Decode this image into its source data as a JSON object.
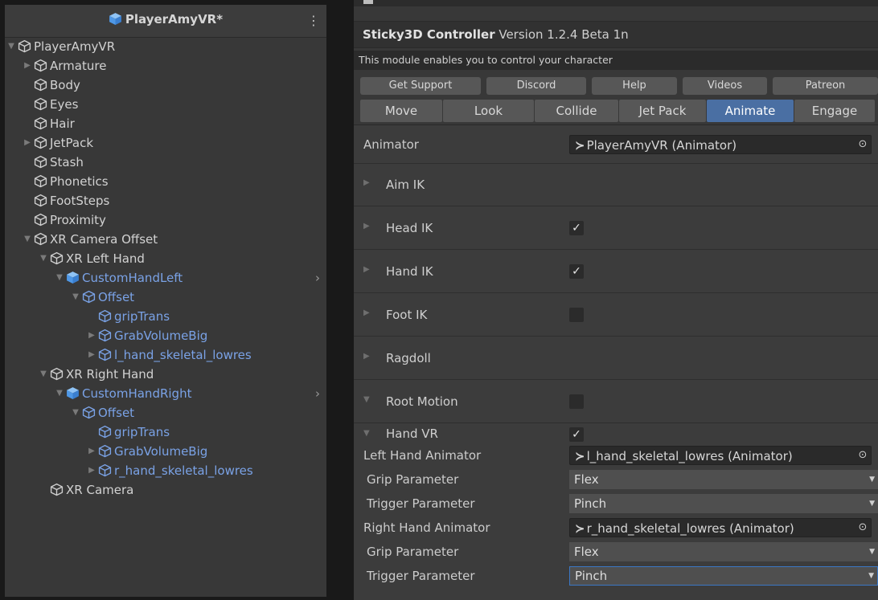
{
  "hierarchy": {
    "title": "PlayerAmyVR*",
    "menu_icon": "vertical-ellipsis-icon",
    "rows": [
      {
        "label": "PlayerAmyVR",
        "depth": 0,
        "arrow": "down",
        "prefab": false
      },
      {
        "label": "Armature",
        "depth": 1,
        "arrow": "right",
        "prefab": false
      },
      {
        "label": "Body",
        "depth": 1,
        "arrow": "none",
        "prefab": false
      },
      {
        "label": "Eyes",
        "depth": 1,
        "arrow": "none",
        "prefab": false
      },
      {
        "label": "Hair",
        "depth": 1,
        "arrow": "none",
        "prefab": false
      },
      {
        "label": "JetPack",
        "depth": 1,
        "arrow": "right",
        "prefab": false
      },
      {
        "label": "Stash",
        "depth": 1,
        "arrow": "none",
        "prefab": false
      },
      {
        "label": "Phonetics",
        "depth": 1,
        "arrow": "none",
        "prefab": false
      },
      {
        "label": "FootSteps",
        "depth": 1,
        "arrow": "none",
        "prefab": false
      },
      {
        "label": "Proximity",
        "depth": 1,
        "arrow": "none",
        "prefab": false
      },
      {
        "label": "XR Camera Offset",
        "depth": 1,
        "arrow": "down",
        "prefab": false
      },
      {
        "label": "XR Left Hand",
        "depth": 2,
        "arrow": "down",
        "prefab": false
      },
      {
        "label": "CustomHandLeft",
        "depth": 3,
        "arrow": "down",
        "prefab": true,
        "root": true
      },
      {
        "label": "Offset",
        "depth": 4,
        "arrow": "down",
        "prefab": true
      },
      {
        "label": "gripTrans",
        "depth": 5,
        "arrow": "none",
        "prefab": true
      },
      {
        "label": "GrabVolumeBig",
        "depth": 5,
        "arrow": "right",
        "prefab": true
      },
      {
        "label": "l_hand_skeletal_lowres",
        "depth": 5,
        "arrow": "right",
        "prefab": true
      },
      {
        "label": "XR Right Hand",
        "depth": 2,
        "arrow": "down",
        "prefab": false
      },
      {
        "label": "CustomHandRight",
        "depth": 3,
        "arrow": "down",
        "prefab": true,
        "root": true
      },
      {
        "label": "Offset",
        "depth": 4,
        "arrow": "down",
        "prefab": true
      },
      {
        "label": "gripTrans",
        "depth": 5,
        "arrow": "none",
        "prefab": true
      },
      {
        "label": "GrabVolumeBig",
        "depth": 5,
        "arrow": "right",
        "prefab": true
      },
      {
        "label": "r_hand_skeletal_lowres",
        "depth": 5,
        "arrow": "right",
        "prefab": true
      },
      {
        "label": "XR Camera",
        "depth": 2,
        "arrow": "none",
        "prefab": false
      }
    ]
  },
  "inspector": {
    "title_bold": "Sticky3D Controller",
    "title_version": " Version 1.2.4 Beta 1n",
    "description": "This module enables you to control your character",
    "support_buttons": [
      "Get Support",
      "Discord",
      "Help",
      "Videos",
      "Patreon"
    ],
    "tabs": [
      "Move",
      "Look",
      "Collide",
      "Jet Pack",
      "Animate",
      "Engage"
    ],
    "active_tab": "Animate",
    "animator": {
      "label": "Animator",
      "value": "PlayerAmyVR (Animator)"
    },
    "foldouts": [
      {
        "name": "Aim IK",
        "has_check": false,
        "checked": false,
        "expanded": false
      },
      {
        "name": "Head IK",
        "has_check": true,
        "checked": true,
        "expanded": false
      },
      {
        "name": "Hand IK",
        "has_check": true,
        "checked": true,
        "expanded": false
      },
      {
        "name": "Foot IK",
        "has_check": true,
        "checked": false,
        "expanded": false
      },
      {
        "name": "Ragdoll",
        "has_check": false,
        "checked": false,
        "expanded": false
      },
      {
        "name": "Root Motion",
        "has_check": true,
        "checked": false,
        "expanded": true
      }
    ],
    "hand_vr": {
      "name": "Hand VR",
      "checked": true,
      "left_animator_label": "Left Hand Animator",
      "left_animator_value": "l_hand_skeletal_lowres (Animator)",
      "left_grip_label": "Grip Parameter",
      "left_grip_value": "Flex",
      "left_trigger_label": "Trigger Parameter",
      "left_trigger_value": "Pinch",
      "right_animator_label": "Right Hand Animator",
      "right_animator_value": "r_hand_skeletal_lowres (Animator)",
      "right_grip_label": "Grip Parameter",
      "right_grip_value": "Flex",
      "right_trigger_label": "Trigger Parameter",
      "right_trigger_value": "Pinch"
    },
    "colors": {
      "active_tab": "#4a6fa3",
      "prefab_text": "#7aa2e6",
      "focus_border": "#3b77c4"
    }
  }
}
